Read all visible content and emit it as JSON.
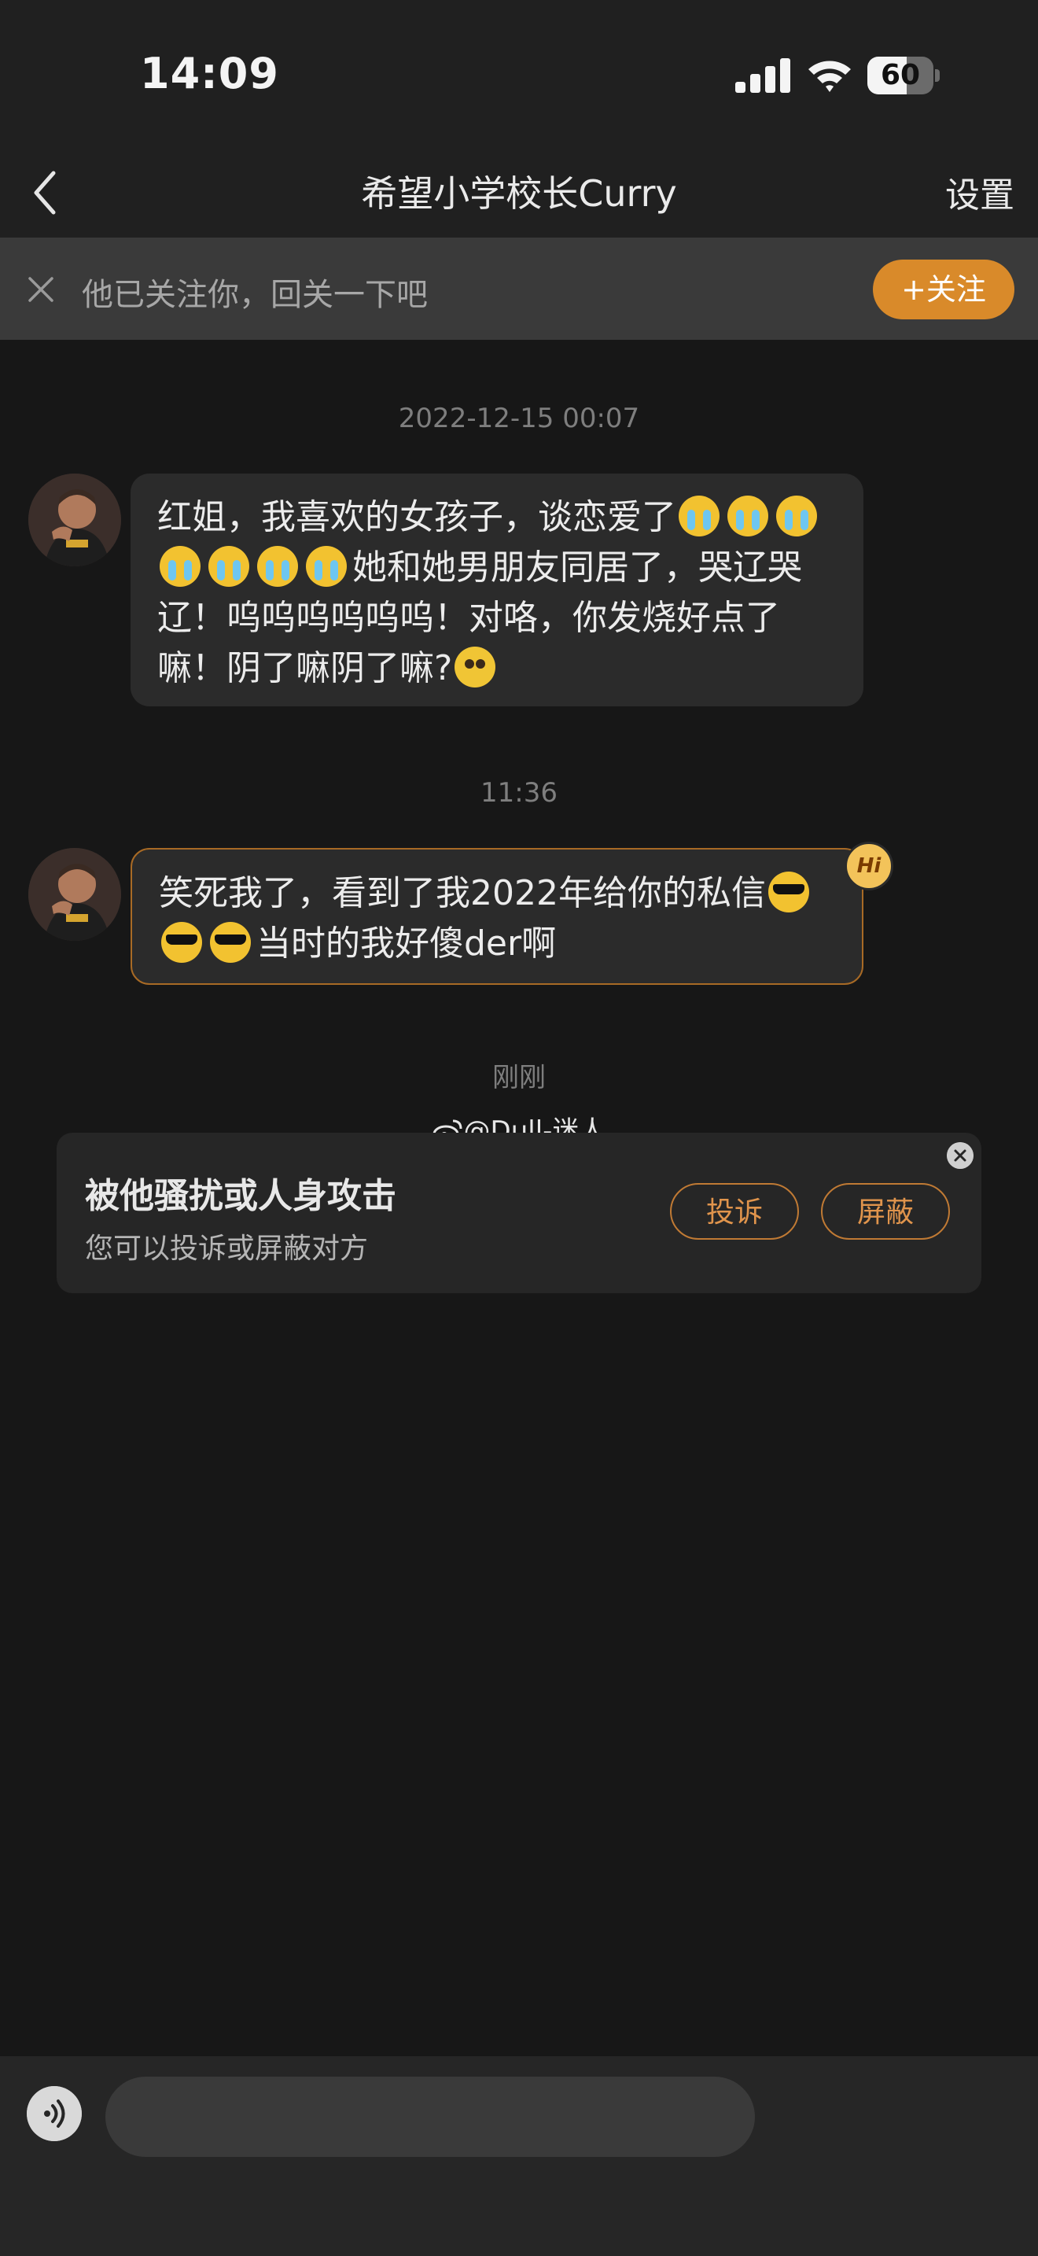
{
  "status_bar": {
    "time": "14:09",
    "battery_level": "60"
  },
  "nav": {
    "title": "希望小学校长Curry",
    "settings_label": "设置"
  },
  "follow_bar": {
    "text": "他已关注你，回关一下吧",
    "button_label": "+关注"
  },
  "messages": [
    {
      "timestamp": "2022-12-15 00:07",
      "parts": {
        "a": "红姐，我喜欢的女孩子，谈恋爱了",
        "b": "她和她男朋友同居了，哭辽哭辽！呜呜呜呜呜呜！对咯，你发烧好点了嘛！阴了嘛阴了嘛?"
      },
      "emojis": [
        "loudly-crying-face",
        "pleading-face"
      ]
    },
    {
      "timestamp": "11:36",
      "parts": {
        "a": "笑死我了，看到了我2022年给你的私信",
        "b": "当时的我好傻der啊"
      },
      "emojis": [
        "smiling-face-with-sunglasses"
      ],
      "badge": "Hi"
    }
  ],
  "notice": {
    "timestamp": "刚刚",
    "watermark": "@Dull-迷人",
    "title": "被他骚扰或人身攻击",
    "subtitle": "您可以投诉或屏蔽对方",
    "report_label": "投诉",
    "block_label": "屏蔽"
  },
  "input": {
    "placeholder": ""
  },
  "colors": {
    "accent": "#d98a2a",
    "background": "#171717",
    "bubble": "#2b2b2b"
  }
}
